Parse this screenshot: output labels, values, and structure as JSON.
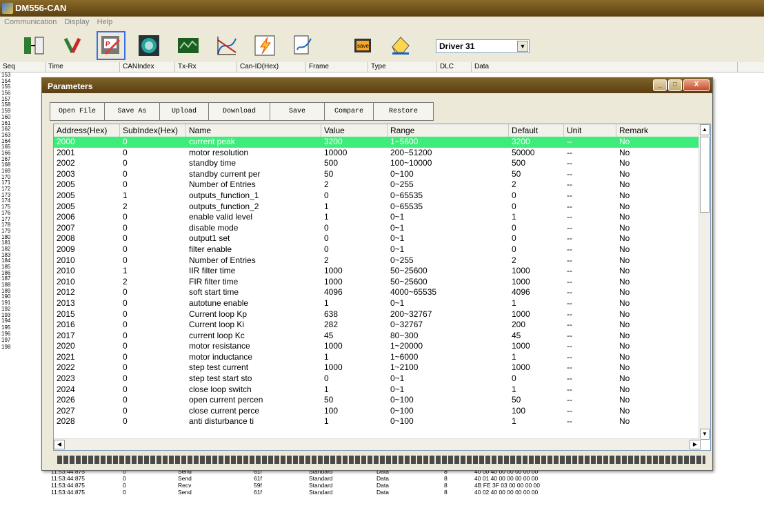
{
  "app": {
    "title": "DM556-CAN"
  },
  "menu": [
    "Communication",
    "Display",
    "Help"
  ],
  "toolbar": {
    "icons": [
      "connect-icon",
      "tools-icon",
      "parameters-icon",
      "target-icon",
      "monitor-icon",
      "chart-icon",
      "flash-icon",
      "signature-icon",
      "save-chip-icon",
      "eraser-icon"
    ],
    "save_chip_label": "save",
    "driver_select": "Driver 31"
  },
  "log_header": [
    "Seq",
    "Time",
    "CANIndex",
    "Tx-Rx",
    "Can-ID(Hex)",
    "Frame",
    "Type",
    "DLC",
    "Data"
  ],
  "seq_numbers": [
    "153",
    "154",
    "155",
    "156",
    "157",
    "158",
    "159",
    "160",
    "161",
    "162",
    "163",
    "164",
    "165",
    "166",
    "167",
    "168",
    "169",
    "170",
    "171",
    "172",
    "173",
    "174",
    "175",
    "176",
    "177",
    "178",
    "179",
    "180",
    "181",
    "182",
    "183",
    "184",
    "185",
    "186",
    "187",
    "188",
    "189",
    "190",
    "191",
    "192",
    "193",
    "194",
    "195",
    "196",
    "197",
    "198"
  ],
  "log_rows": [
    {
      "time": "11:53:44:875",
      "idx": "0",
      "txrx": "Send",
      "canid": "61f",
      "frame": "Standard",
      "type": "Data",
      "dlc": "8",
      "data": "40 00 40 00 00 00 00 00"
    },
    {
      "time": "11:53:44:875",
      "idx": "0",
      "txrx": "Send",
      "canid": "61f",
      "frame": "Standard",
      "type": "Data",
      "dlc": "8",
      "data": "40 01 40 00 00 00 00 00"
    },
    {
      "time": "11:53:44:875",
      "idx": "0",
      "txrx": "Recv",
      "canid": "59f",
      "frame": "Standard",
      "type": "Data",
      "dlc": "8",
      "data": "4B FE 3F 03 00 00 00 00"
    },
    {
      "time": "11:53:44:875",
      "idx": "0",
      "txrx": "Send",
      "canid": "61f",
      "frame": "Standard",
      "type": "Data",
      "dlc": "8",
      "data": "40 02 40 00 00 00 00 00"
    }
  ],
  "dialog": {
    "title": "Parameters",
    "buttons": [
      "Open File",
      "Save As",
      "Upload",
      "Download",
      "Save",
      "Compare",
      "Restore"
    ],
    "columns": [
      "Address(Hex)",
      "SubIndex(Hex)",
      "Name",
      "Value",
      "Range",
      "Default",
      "Unit",
      "Remark"
    ],
    "rows": [
      [
        "2000",
        "0",
        "current peak",
        "3200",
        "1~5600",
        "3200",
        "--",
        "No"
      ],
      [
        "2001",
        "0",
        "motor resolution",
        "10000",
        "200~51200",
        "50000",
        "--",
        "No"
      ],
      [
        "2002",
        "0",
        "standby time",
        "500",
        "100~10000",
        "500",
        "--",
        "No"
      ],
      [
        "2003",
        "0",
        "standby current per",
        "50",
        "0~100",
        "50",
        "--",
        "No"
      ],
      [
        "2005",
        "0",
        "Number of Entries",
        "2",
        "0~255",
        "2",
        "--",
        "No"
      ],
      [
        "2005",
        "1",
        "outputs_function_1",
        "0",
        "0~65535",
        "0",
        "--",
        "No"
      ],
      [
        "2005",
        "2",
        "outputs_function_2",
        "1",
        "0~65535",
        "0",
        "--",
        "No"
      ],
      [
        "2006",
        "0",
        "enable valid level",
        "1",
        "0~1",
        "1",
        "--",
        "No"
      ],
      [
        "2007",
        "0",
        "disable mode",
        "0",
        "0~1",
        "0",
        "--",
        "No"
      ],
      [
        "2008",
        "0",
        "output1 set",
        "0",
        "0~1",
        "0",
        "--",
        "No"
      ],
      [
        "2009",
        "0",
        "filter enable",
        "0",
        "0~1",
        "0",
        "--",
        "No"
      ],
      [
        "2010",
        "0",
        "Number of Entries",
        "2",
        "0~255",
        "2",
        "--",
        "No"
      ],
      [
        "2010",
        "1",
        "IIR filter time",
        "1000",
        "50~25600",
        "1000",
        "--",
        "No"
      ],
      [
        "2010",
        "2",
        "FIR filter time",
        "1000",
        "50~25600",
        "1000",
        "--",
        "No"
      ],
      [
        "2012",
        "0",
        "soft start time",
        "4096",
        "4000~65535",
        "4096",
        "--",
        "No"
      ],
      [
        "2013",
        "0",
        "autotune enable",
        "1",
        "0~1",
        "1",
        "--",
        "No"
      ],
      [
        "2015",
        "0",
        "Current loop Kp",
        "638",
        "200~32767",
        "1000",
        "--",
        "No"
      ],
      [
        "2016",
        "0",
        "Current loop Ki",
        "282",
        "0~32767",
        "200",
        "--",
        "No"
      ],
      [
        "2017",
        "0",
        "current loop Kc",
        "45",
        "80~300",
        "45",
        "--",
        "No"
      ],
      [
        "2020",
        "0",
        "motor resistance",
        "1000",
        "1~20000",
        "1000",
        "--",
        "No"
      ],
      [
        "2021",
        "0",
        "motor inductance",
        "1",
        "1~6000",
        "1",
        "--",
        "No"
      ],
      [
        "2022",
        "0",
        "step test current",
        "1000",
        "1~2100",
        "1000",
        "--",
        "No"
      ],
      [
        "2023",
        "0",
        "step test start sto",
        "0",
        "0~1",
        "0",
        "--",
        "No"
      ],
      [
        "2024",
        "0",
        "close loop switch",
        "1",
        "0~1",
        "1",
        "--",
        "No"
      ],
      [
        "2026",
        "0",
        "open current percen",
        "50",
        "0~100",
        "50",
        "--",
        "No"
      ],
      [
        "2027",
        "0",
        "close current perce",
        "100",
        "0~100",
        "100",
        "--",
        "No"
      ],
      [
        "2028",
        "0",
        "anti disturbance ti",
        "1",
        "0~100",
        "1",
        "--",
        "No"
      ]
    ],
    "selected_row": 0
  }
}
